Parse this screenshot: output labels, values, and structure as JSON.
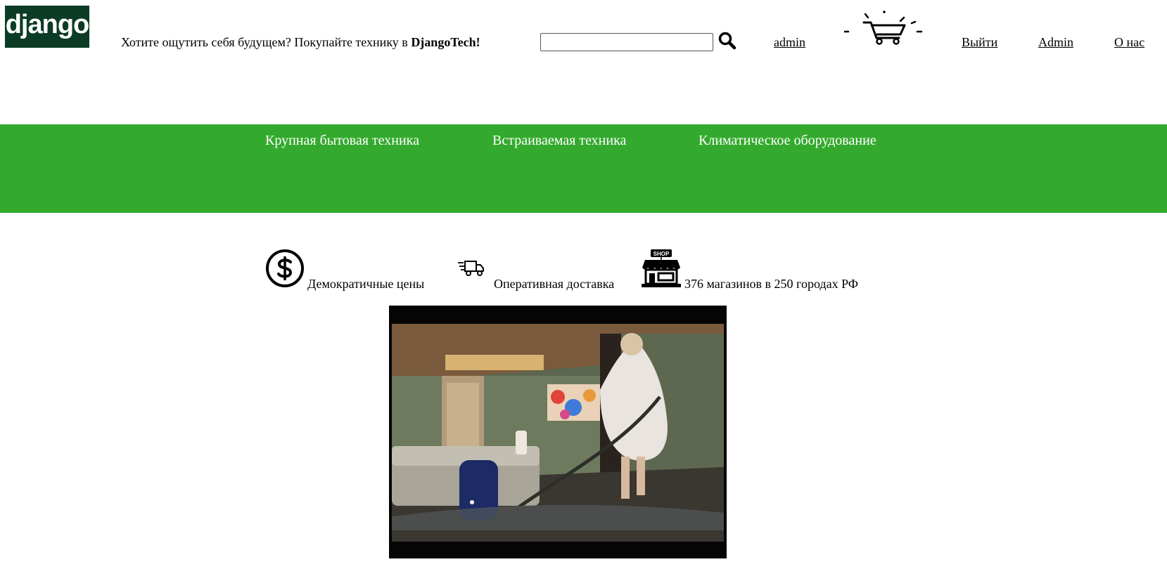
{
  "header": {
    "logo_text": "django",
    "tagline_prefix": "Хотите ощутить себя будущем? Покупайте технику в ",
    "tagline_brand": "DjangoTech!",
    "search": {
      "value": "",
      "placeholder": ""
    },
    "search_icon": "search-icon",
    "user_link": "admin",
    "cart_icon": "shopping-cart-icon",
    "logout_link": "Выйти",
    "admin_link": "Admin",
    "about_link": "О нас"
  },
  "categories": [
    {
      "label": "Крупная бытовая техника"
    },
    {
      "label": "Встраиваемая техника"
    },
    {
      "label": "Климатическое оборудование"
    }
  ],
  "features": [
    {
      "icon": "dollar-icon",
      "label": "Демократичные цены"
    },
    {
      "icon": "delivery-truck-icon",
      "label": "Оперативная доставка"
    },
    {
      "icon": "shop-icon",
      "label": "376 магазинов в 250 городах РФ",
      "icon_text": "SHOP"
    }
  ],
  "video": {
    "icon": "video-player"
  },
  "colors": {
    "logo_bg": "#0c3c26",
    "category_band": "#33aa2d",
    "text": "#000000",
    "category_text": "#ffffff"
  }
}
